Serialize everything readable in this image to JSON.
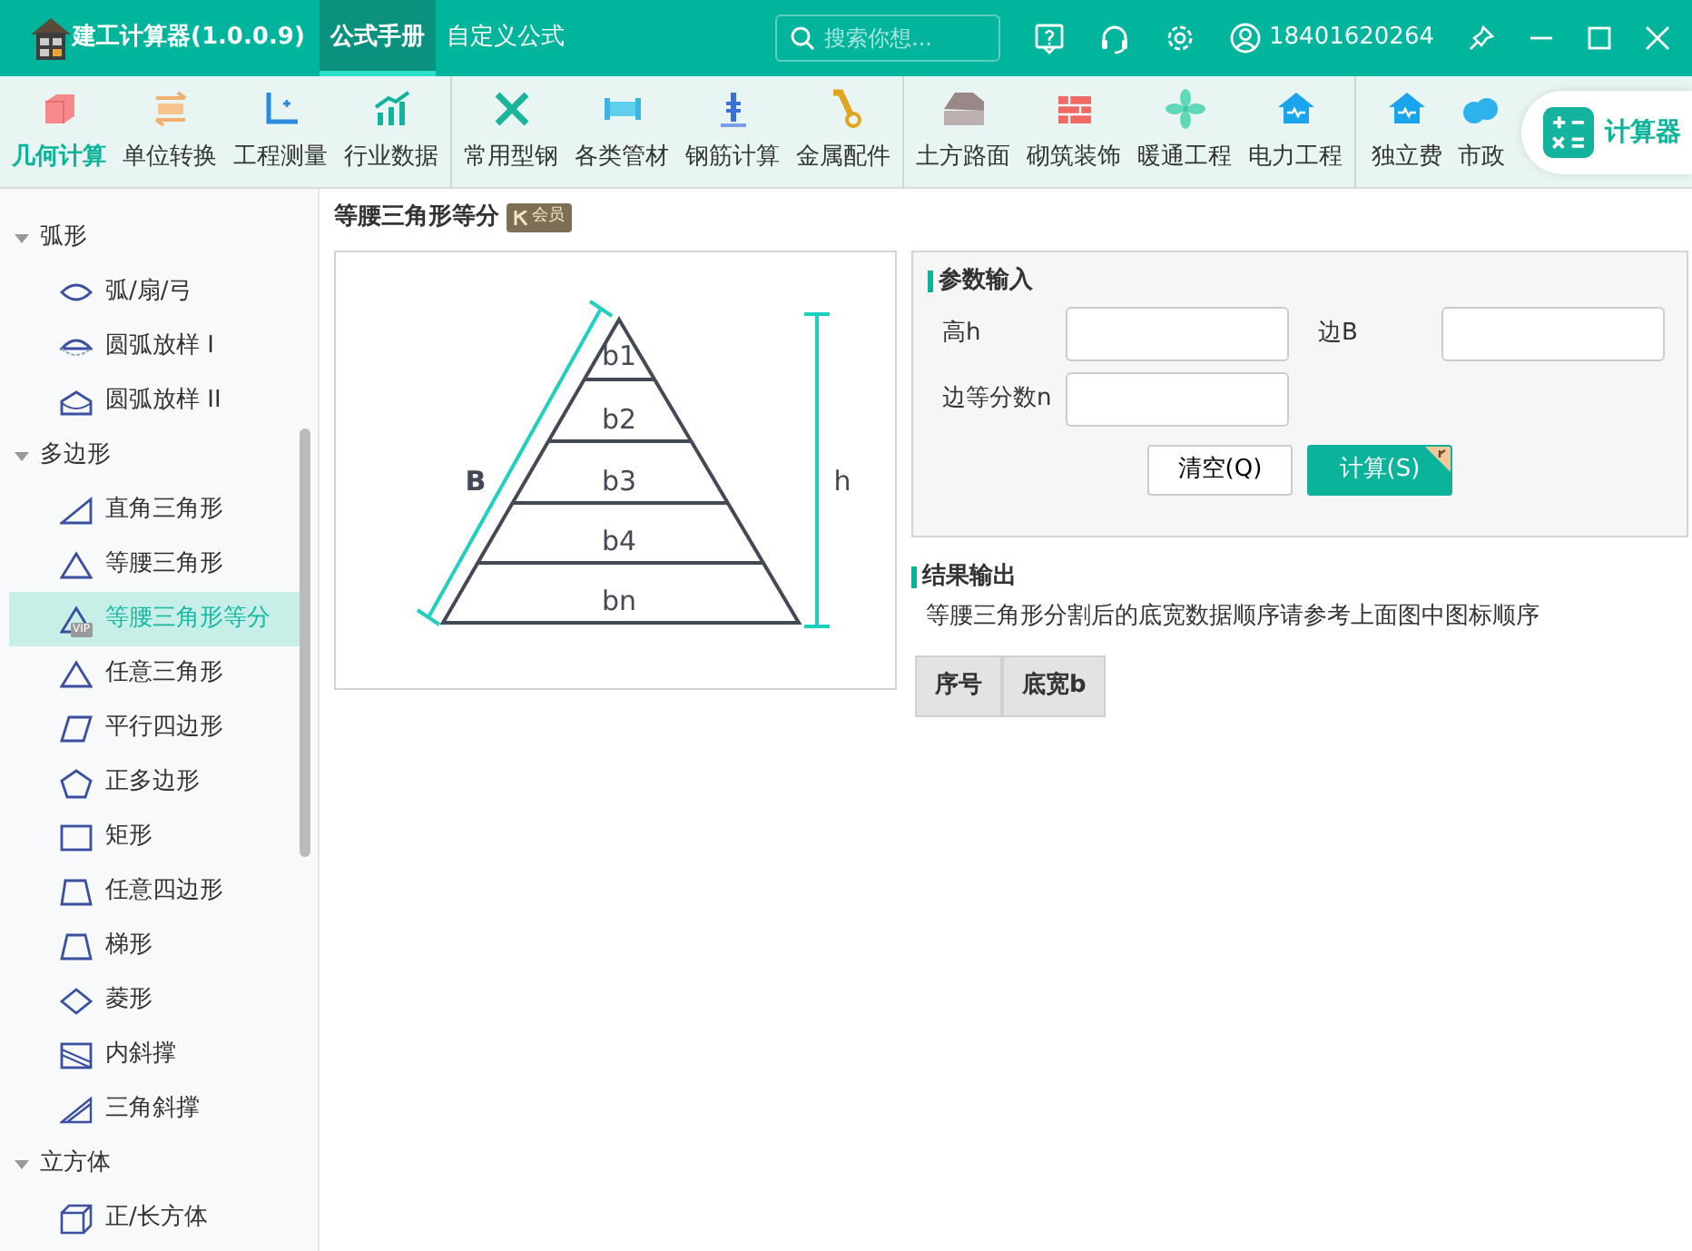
{
  "window": {
    "title": "建工计算器(1.0.0.9)"
  },
  "top_tabs": [
    {
      "label": "公式手册",
      "selected": true
    },
    {
      "label": "自定义公式",
      "selected": false
    }
  ],
  "search": {
    "placeholder": "搜索你想..."
  },
  "user": {
    "phone": "18401620264"
  },
  "toolbar": {
    "groups": [
      [
        {
          "label": "几何计算",
          "selected": true
        },
        {
          "label": "单位转换",
          "selected": false
        },
        {
          "label": "工程测量",
          "selected": false
        },
        {
          "label": "行业数据",
          "selected": false
        }
      ],
      [
        {
          "label": "常用型钢",
          "selected": false
        },
        {
          "label": "各类管材",
          "selected": false
        },
        {
          "label": "钢筋计算",
          "selected": false
        },
        {
          "label": "金属配件",
          "selected": false
        }
      ],
      [
        {
          "label": "土方路面",
          "selected": false
        },
        {
          "label": "砌筑装饰",
          "selected": false
        },
        {
          "label": "暖通工程",
          "selected": false
        },
        {
          "label": "电力工程",
          "selected": false
        }
      ],
      [
        {
          "label": "独立费",
          "selected": false
        },
        {
          "label": "市政",
          "selected": false
        }
      ]
    ]
  },
  "floating_button": {
    "label": "计算器"
  },
  "sidebar": {
    "groups": [
      {
        "label": "弧形",
        "expanded": true,
        "children": [
          {
            "label": "弧/扇/弓",
            "selected": false
          },
          {
            "label": "圆弧放样 I",
            "selected": false
          },
          {
            "label": "圆弧放样 II",
            "selected": false
          }
        ]
      },
      {
        "label": "多边形",
        "expanded": true,
        "children": [
          {
            "label": "直角三角形",
            "selected": false
          },
          {
            "label": "等腰三角形",
            "selected": false
          },
          {
            "label": "等腰三角形等分",
            "selected": true,
            "tag": "VIP"
          },
          {
            "label": "任意三角形",
            "selected": false
          },
          {
            "label": "平行四边形",
            "selected": false
          },
          {
            "label": "正多边形",
            "selected": false
          },
          {
            "label": "矩形",
            "selected": false
          },
          {
            "label": "任意四边形",
            "selected": false
          },
          {
            "label": "梯形",
            "selected": false
          },
          {
            "label": "菱形",
            "selected": false
          },
          {
            "label": "内斜撑",
            "selected": false
          },
          {
            "label": "三角斜撑",
            "selected": false
          }
        ]
      },
      {
        "label": "立方体",
        "expanded": true,
        "children": [
          {
            "label": "正/长方体",
            "selected": false
          }
        ]
      }
    ]
  },
  "page": {
    "title": "等腰三角形等分",
    "badge": "会员"
  },
  "diagram": {
    "segments": [
      "b1",
      "b2",
      "b3",
      "b4",
      "bn"
    ],
    "side_label": "B",
    "height_label": "h"
  },
  "params": {
    "title": "参数输入",
    "fields": [
      {
        "label": "高h"
      },
      {
        "label": "边B"
      },
      {
        "label": "边等分数n"
      }
    ],
    "buttons": [
      {
        "label": "清空(Q)",
        "kind": "secondary"
      },
      {
        "label": "计算(S)",
        "kind": "primary"
      }
    ]
  },
  "results": {
    "title": "结果输出",
    "note": "等腰三角形分割后的底宽数据顺序请参考上面图中图标顺序",
    "columns": [
      "序号",
      "底宽b"
    ]
  }
}
